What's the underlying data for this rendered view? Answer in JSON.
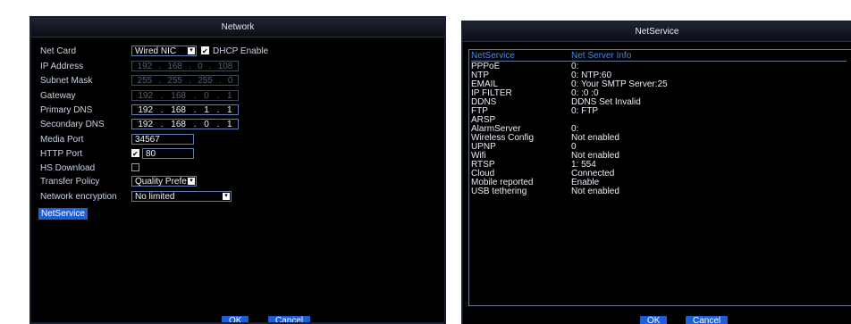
{
  "network": {
    "title": "Network",
    "labels": {
      "net_card": "Net Card",
      "ip_address": "IP Address",
      "subnet_mask": "Subnet Mask",
      "gateway": "Gateway",
      "primary_dns": "Primary DNS",
      "secondary_dns": "Secondary DNS",
      "media_port": "Media Port",
      "http_port": "HTTP Port",
      "hs_download": "HS Download",
      "transfer_policy": "Transfer Policy",
      "network_encryption": "Network encryption"
    },
    "net_card_value": "Wired NIC",
    "dhcp_label": "DHCP Enable",
    "ip_address": [
      "192",
      "168",
      "0",
      "108"
    ],
    "subnet_mask": [
      "255",
      "255",
      "255",
      "0"
    ],
    "gateway": [
      "192",
      "168",
      "0",
      "1"
    ],
    "primary_dns": [
      "192",
      "168",
      "1",
      "1"
    ],
    "secondary_dns": [
      "192",
      "168",
      "0",
      "1"
    ],
    "media_port": "34567",
    "http_port": "80",
    "transfer_policy_value": "Quality Prefe",
    "network_encryption_value": "No limited",
    "netservice_button": "NetService",
    "ok_label": "OK",
    "cancel_label": "Cancel"
  },
  "netservice": {
    "title": "NetService",
    "headers": [
      "NetService",
      "Net Server Info"
    ],
    "rows": [
      [
        "PPPoE",
        "0:"
      ],
      [
        "NTP",
        "0: NTP:60"
      ],
      [
        "EMAIL",
        "0: Your SMTP Server:25"
      ],
      [
        "IP FILTER",
        "0: :0 :0"
      ],
      [
        "DDNS",
        "DDNS Set Invalid"
      ],
      [
        "FTP",
        "0: FTP"
      ],
      [
        "ARSP",
        ""
      ],
      [
        "AlarmServer",
        "0:"
      ],
      [
        "Wireless Config",
        "Not enabled"
      ],
      [
        "UPNP",
        "0"
      ],
      [
        "Wifi",
        "Not enabled"
      ],
      [
        "RTSP",
        "1: 554"
      ],
      [
        "Cloud",
        "Connected"
      ],
      [
        "Mobile reported",
        "Enable"
      ],
      [
        "USB tethering",
        "Not enabled"
      ]
    ],
    "ok_label": "OK",
    "cancel_label": "Cancel"
  },
  "colors": {
    "panel_bg": "#000000",
    "button_blue": "#1c5fd6",
    "header_blue": "#4a89e8",
    "field_border": "#5f7fb0"
  }
}
